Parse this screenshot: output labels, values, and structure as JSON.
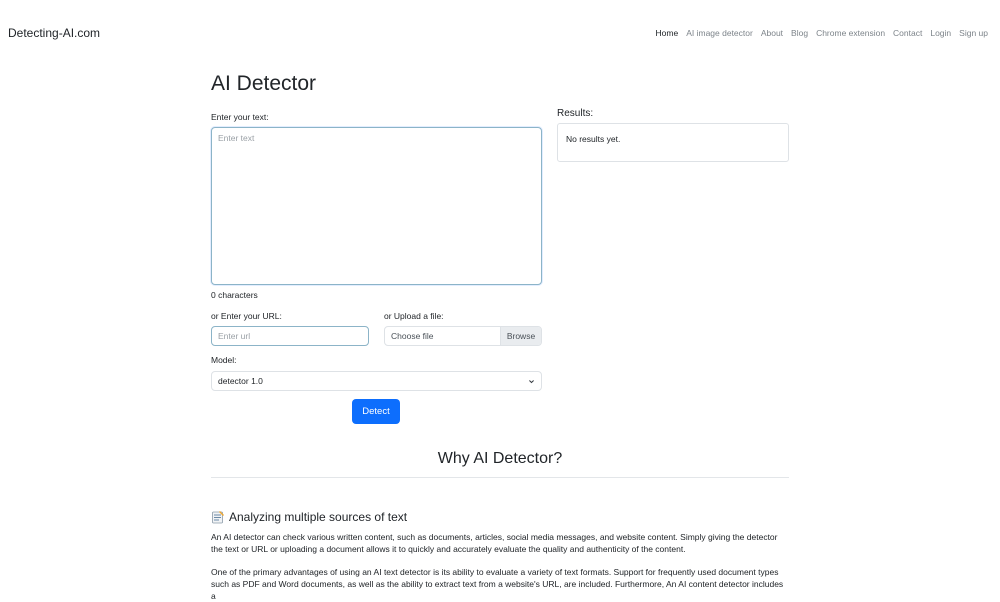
{
  "nav": {
    "brand": "Detecting-AI.com",
    "links": [
      "Home",
      "AI image detector",
      "About",
      "Blog",
      "Chrome extension",
      "Contact",
      "Login",
      "Sign up"
    ]
  },
  "main": {
    "title": "AI Detector",
    "text_label": "Enter your text:",
    "text_placeholder": "Enter text",
    "char_count": "0 characters",
    "url_label": "or Enter your URL:",
    "url_placeholder": "Enter url",
    "file_label": "or Upload a file:",
    "file_text": "Choose file",
    "browse_label": "Browse",
    "model_label": "Model:",
    "model_selected": "detector 1.0",
    "detect_label": "Detect"
  },
  "results": {
    "title": "Results:",
    "empty_text": "No results yet."
  },
  "why": {
    "title": "Why AI Detector?",
    "section_heading": "Analyzing multiple sources of text",
    "para1": "An AI detector can check various written content, such as documents, articles, social media messages, and website content. Simply giving the detector the text or URL or uploading a document allows it to quickly and accurately evaluate the quality and authenticity of the content.",
    "para2": "One of the primary advantages of using an AI text detector is its ability to evaluate a variety of text formats. Support for frequently used document types such as PDF and Word documents, as well as the ability to extract text from a website's URL, are included. Furthermore, An AI content detector includes a"
  },
  "colors": {
    "primary": "#0d6efd",
    "nav_muted": "#7d848a"
  }
}
